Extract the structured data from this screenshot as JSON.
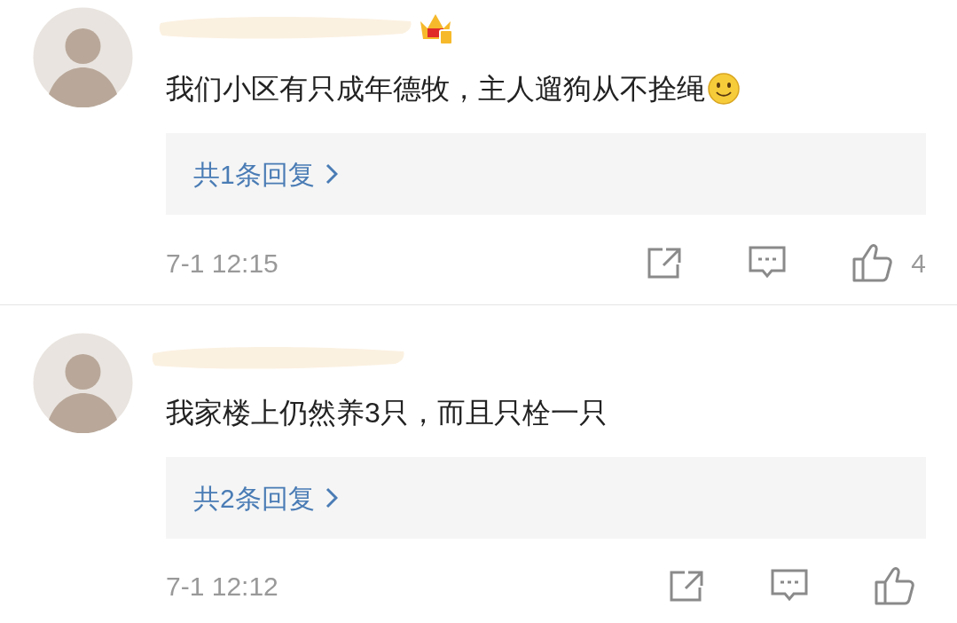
{
  "comments": [
    {
      "vip": true,
      "text": "我们小区有只成年德牧，主人遛狗从不拴绳",
      "emoji": true,
      "replies": "共1条回复",
      "time": "7-1 12:15",
      "likes": "4"
    },
    {
      "vip": false,
      "text": "我家楼上仍然养3只，而且只栓一只",
      "emoji": false,
      "replies": "共2条回复",
      "time": "7-1 12:12"
    }
  ]
}
